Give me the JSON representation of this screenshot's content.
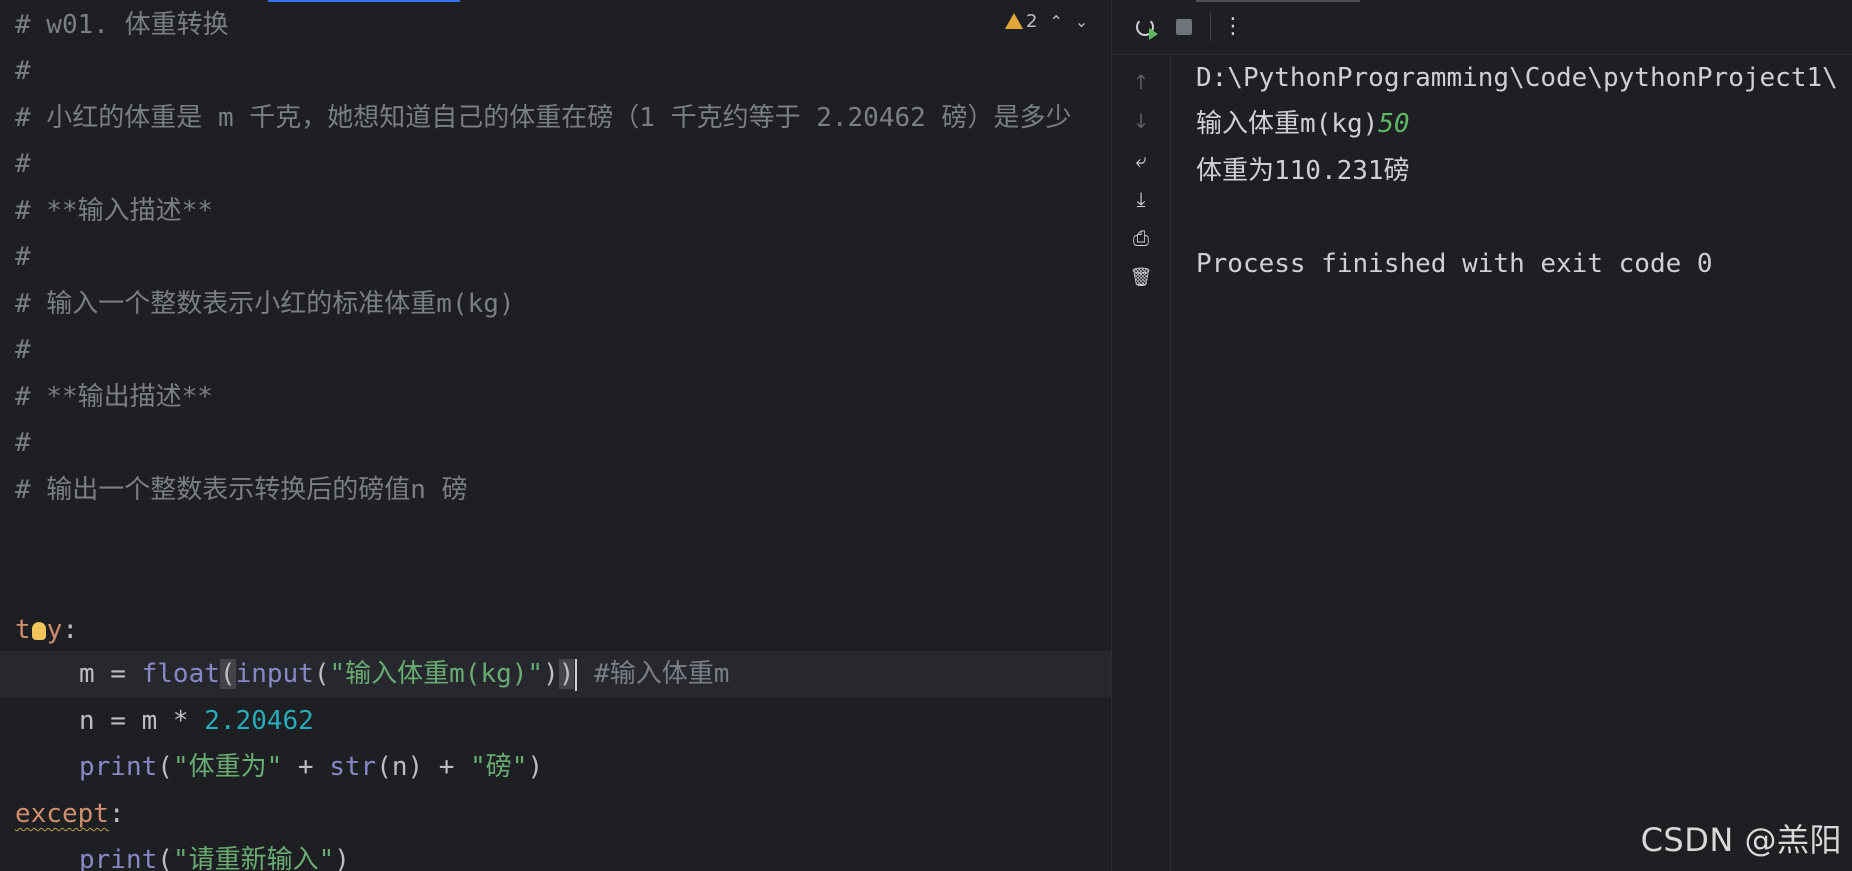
{
  "editor": {
    "inspection": {
      "warning_count": "2",
      "up_icon": "chevron-up-icon",
      "down_icon": "chevron-down-icon"
    },
    "comments": [
      "# w01. 体重转换",
      "#",
      "# 小红的体重是 m 千克，她想知道自己的体重在磅（1 千克约等于 2.20462 磅）是多少",
      "#",
      "# **输入描述**",
      "#",
      "# 输入一个整数表示小红的标准体重m(kg)",
      "#",
      "# **输出描述**",
      "#",
      "# 输出一个整数表示转换后的磅值n 磅"
    ],
    "code": {
      "try_kw_start": "t",
      "try_kw_end": "y",
      "colon": ":",
      "line1": {
        "var": "m",
        "assign": " = ",
        "float_fn": "float",
        "open1": "(",
        "input_fn": "input",
        "open2": "(",
        "prompt": "\"输入体重m(kg)\"",
        "close2": ")",
        "close1": ")",
        "comment": "#输入体重m"
      },
      "line2": {
        "lhs": "n = m * ",
        "factor": "2.20462"
      },
      "line3": {
        "print_fn": "print",
        "open": "(",
        "str1": "\"体重为\"",
        "plus1": " + ",
        "str_fn": "str",
        "arg": "(n)",
        "plus2": " + ",
        "str2": "\"磅\"",
        "close": ")"
      },
      "except_kw": "except",
      "except_colon": ":",
      "line5": {
        "print_fn": "print",
        "open": "(",
        "str": "\"请重新输入\"",
        "close": ")"
      }
    }
  },
  "run": {
    "toolbar": {
      "rerun_icon": "rerun-icon",
      "stop_icon": "stop-icon",
      "more_icon": "more-vertical-icon",
      "more_glyph": "⋮"
    },
    "side_icons": {
      "up_glyph": "↑",
      "down_glyph": "↓",
      "wrap_glyph": "⤶",
      "scroll_end_glyph": "⤓",
      "print_glyph": "⎙",
      "trash_glyph": "🗑"
    },
    "console": {
      "command": "D:\\PythonProgramming\\Code\\pythonProject1\\",
      "prompt": "输入体重m(kg)",
      "user_input": "50",
      "result": "体重为110.231磅",
      "exit_msg": "Process finished with exit code 0"
    }
  },
  "watermark": "CSDN @羔阳",
  "colors": {
    "background": "#1e1f22",
    "comment": "#7a7e85",
    "keyword": "#cf8e6d",
    "builtin": "#8888c6",
    "string": "#6aab73",
    "number": "#2aacb8",
    "input_echo": "#5fb865"
  }
}
